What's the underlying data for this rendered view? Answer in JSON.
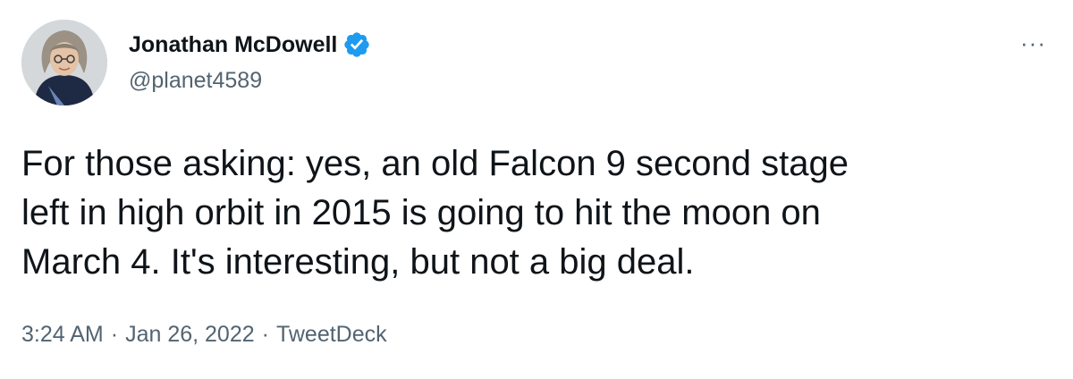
{
  "author": {
    "display_name": "Jonathan McDowell",
    "handle": "@planet4589",
    "verified": true,
    "avatar_icon": "profile-photo"
  },
  "menu": {
    "more_label": "···"
  },
  "tweet": {
    "lines": [
      "For those asking: yes, an old Falcon 9 second stage",
      "left in high orbit in 2015 is going to hit the moon on",
      "March 4. It's interesting, but not a big deal."
    ]
  },
  "meta": {
    "time": "3:24 AM",
    "separator": "·",
    "date": "Jan 26, 2022",
    "source": "TweetDeck"
  },
  "colors": {
    "text": "#0f1419",
    "secondary": "#536471",
    "verified_blue": "#1d9bf0"
  }
}
